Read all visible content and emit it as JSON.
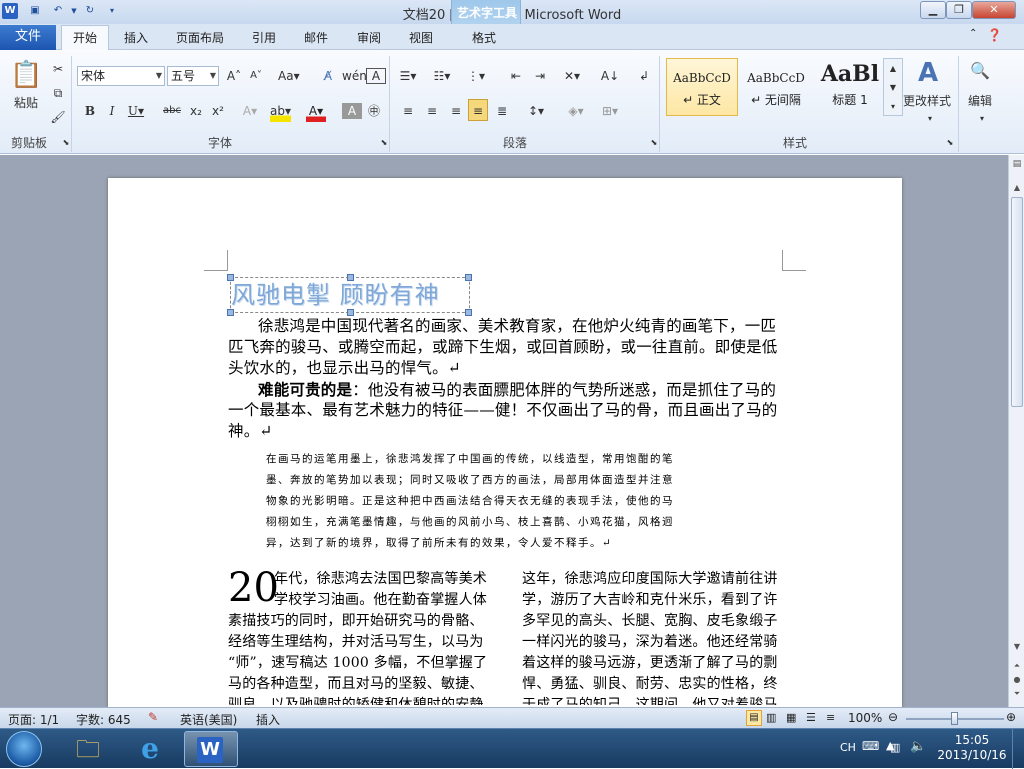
{
  "window": {
    "title": "文档20 [兼容模式] - Microsoft Word",
    "context_tab": "艺术字工具"
  },
  "tabs": {
    "file": "文件",
    "home": "开始",
    "insert": "插入",
    "layout": "页面布局",
    "references": "引用",
    "mailings": "邮件",
    "review": "审阅",
    "view": "视图",
    "format": "格式"
  },
  "ribbon": {
    "clipboard": {
      "paste": "粘贴",
      "label": "剪贴板"
    },
    "font": {
      "name": "宋体",
      "size": "五号",
      "label": "字体"
    },
    "paragraph": {
      "label": "段落"
    },
    "styles": {
      "label": "样式",
      "items": [
        {
          "preview": "AaBbCcD",
          "name": "↵ 正文"
        },
        {
          "preview": "AaBbCcD",
          "name": "↵ 无间隔"
        },
        {
          "preview": "AaBl",
          "name": "标题 1"
        }
      ],
      "change_styles": "更改样式"
    },
    "editing": {
      "label": "编辑"
    }
  },
  "document": {
    "wordart": "风驰电掣  顾盼有神",
    "para1_a": "徐悲鸿是中国现代著名的画家、美术教育家，在他炉火纯青的画笔下，一匹",
    "para1_b": "匹飞奔的骏马、或腾空而起，或蹄下生烟，或回首顾盼，或一往直前。即使是低",
    "para1_c": "头饮水的，也显示出马的悍气。↵",
    "para2_bold": "难能可贵的是",
    "para2_a": "：他没有被马的表面膘肥体胖的气势所迷惑，而是抓住了马的",
    "para2_b": "一个最基本、最有艺术魅力的特征——健！不仅画出了马的骨，而且画出了马的",
    "para2_c": "神。↵",
    "quote_lines": [
      "在画马的运笔用墨上，徐悲鸿发挥了中国画的传统，以线造型，常用饱酣的笔",
      "墨、奔放的笔势加以表现；同时又吸收了西方的画法，局部用体面造型并注意",
      "物象的光影明暗。正是这种把中西画法结合得天衣无缝的表现手法，使他的马",
      "栩栩如生，充满笔墨情趣，与他画的风前小鸟、枝上喜鹊、小鸡花猫，风格迥",
      "异，达到了新的境界，取得了前所未有的效果，令人爱不释手。↵"
    ],
    "dropcap": "20",
    "col1_lines": [
      "年代，徐悲鸿去法国巴黎高等美术",
      "学校学习油画。他在勤奋掌握人体",
      "素描技巧的同时，即开始研究马的骨骼、",
      "经络等生理结构，并对活马写生，以马为",
      "“师”，速写稿达 1000 多幅，不但掌握了",
      "马的各种造型，而且对马的坚毅、敏捷、",
      "驯良、以及驰骋时的矫健和休憩时的安静"
    ],
    "col2_lines": [
      "这年，徐悲鸿应印度国际大学邀请前往讲",
      "学，游历了大吉岭和克什米乐，看到了许",
      "多罕见的高头、长腿、宽胸、皮毛象缎子",
      "一样闪光的骏马，深为着迷。他还经常骑",
      "着这样的骏马远游，更透渐了解了马的剽",
      "悍、勇猛、驯良、耐劳、忠实的性格，终",
      "于成了马的知己。这期间，他又对着骏马"
    ]
  },
  "status": {
    "page": "页面: 1/1",
    "words": "字数: 645",
    "language": "英语(美国)",
    "mode": "插入",
    "zoom": "100%"
  },
  "taskbar": {
    "ime": "CH",
    "time": "15:05",
    "date": "2013/10/16"
  },
  "colors": {
    "accent": "#2b63c3",
    "wordart": "#7fa8d8"
  }
}
